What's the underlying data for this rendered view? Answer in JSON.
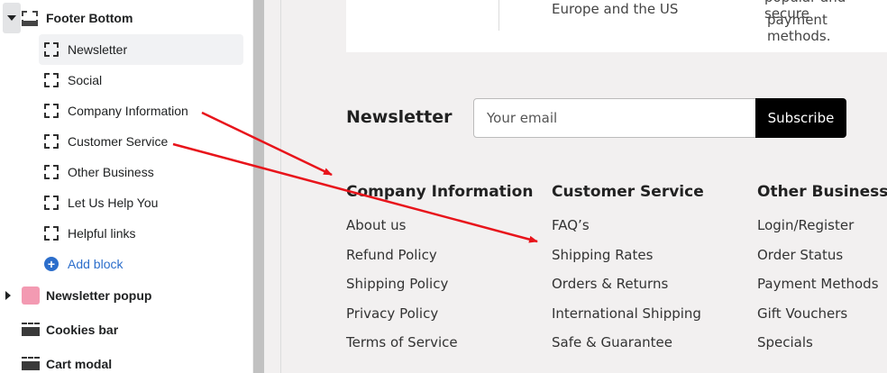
{
  "sidebar": {
    "section": {
      "label": "Footer Bottom",
      "icon": "section-footer-icon"
    },
    "blocks": [
      {
        "label": "Newsletter",
        "icon": "block-dashed-icon",
        "selected": true
      },
      {
        "label": "Social",
        "icon": "block-dashed-icon"
      },
      {
        "label": "Company Information",
        "icon": "block-dashed-icon"
      },
      {
        "label": "Customer Service",
        "icon": "block-dashed-icon"
      },
      {
        "label": "Other Business",
        "icon": "block-dashed-icon"
      },
      {
        "label": "Let Us Help You",
        "icon": "block-dashed-icon"
      },
      {
        "label": "Helpful links",
        "icon": "block-dashed-icon"
      }
    ],
    "add_block": {
      "label": "Add block",
      "icon": "plus-circle-icon",
      "color": "#2c6ecb"
    },
    "sections": [
      {
        "label": "Newsletter popup",
        "icon": "pink-section-icon",
        "color": "#f39ab2"
      },
      {
        "label": "Cookies bar",
        "icon": "bar-section-icon"
      },
      {
        "label": "Cart modal",
        "icon": "bar-section-icon"
      }
    ]
  },
  "preview": {
    "top_card": {
      "text_left": "Europe and the US",
      "text_right_1": "popular and secure",
      "text_right_2": "payment methods."
    },
    "newsletter": {
      "title": "Newsletter",
      "placeholder": "Your email",
      "button": "Subscribe"
    },
    "columns": [
      {
        "title": "Company Information",
        "links": [
          "About us",
          "Refund Policy",
          "Shipping Policy",
          "Privacy Policy",
          "Terms of Service"
        ]
      },
      {
        "title": "Customer Service",
        "links": [
          "FAQ’s",
          "Shipping Rates",
          "Orders & Returns",
          "International Shipping",
          "Safe & Guarantee"
        ]
      },
      {
        "title": "Other Business",
        "links": [
          "Login/Register",
          "Order Status",
          "Payment Methods",
          "Gift Vouchers",
          "Specials"
        ]
      }
    ],
    "annotation_color": "#e8141b"
  }
}
